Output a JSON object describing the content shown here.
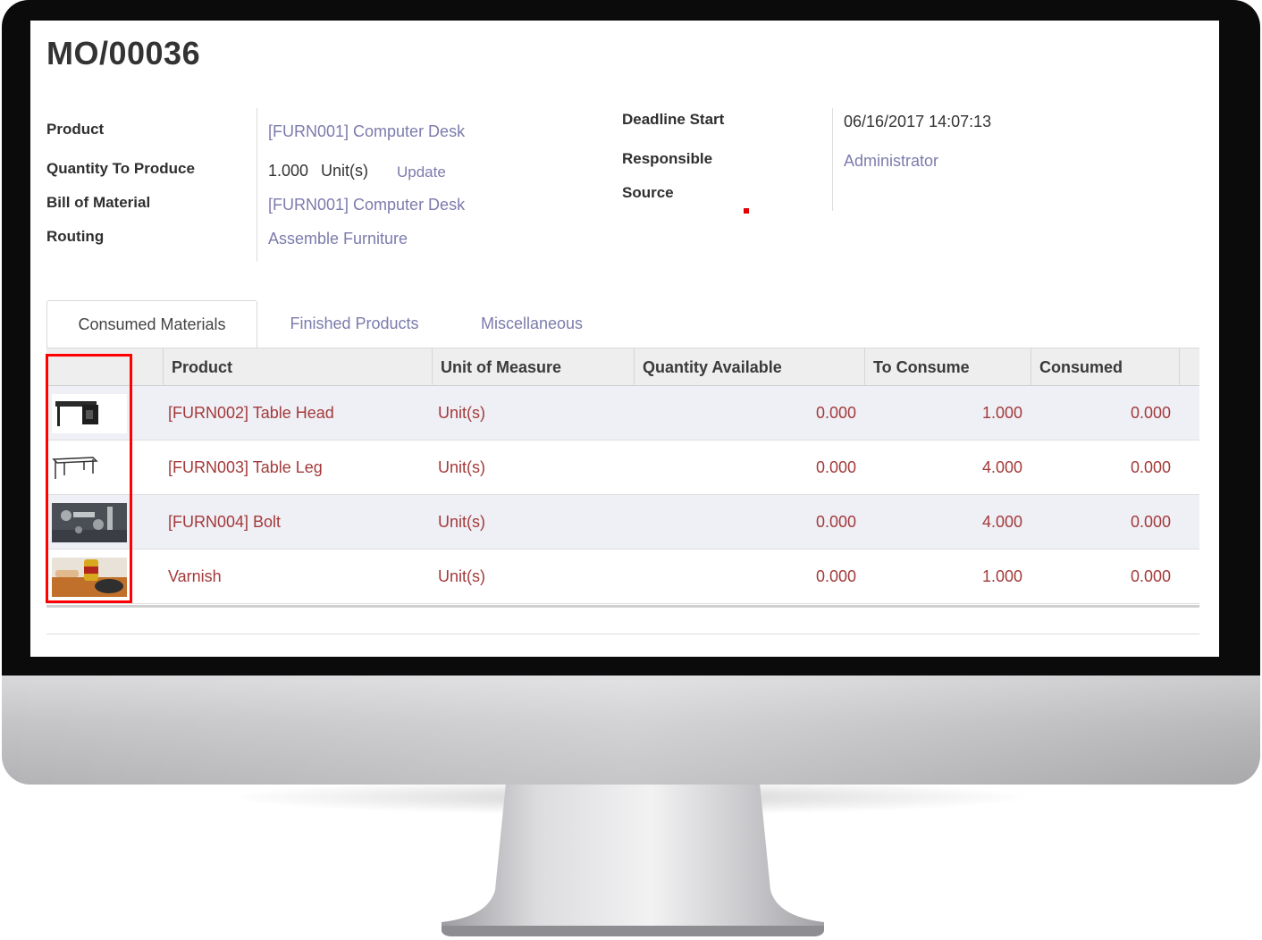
{
  "record": {
    "title": "MO/00036"
  },
  "fields_left": {
    "product_label": "Product",
    "product_value": "[FURN001] Computer Desk",
    "quantity_label": "Quantity To Produce",
    "quantity_value": "1.000",
    "quantity_uom": "Unit(s)",
    "update_link": "Update",
    "bom_label": "Bill of Material",
    "bom_value": "[FURN001] Computer Desk",
    "routing_label": "Routing",
    "routing_value": "Assemble Furniture"
  },
  "fields_right": {
    "deadline_label": "Deadline Start",
    "deadline_value": "06/16/2017 14:07:13",
    "responsible_label": "Responsible",
    "responsible_value": "Administrator",
    "source_label": "Source"
  },
  "tabs": [
    {
      "label": "Consumed Materials",
      "active": true
    },
    {
      "label": "Finished Products",
      "active": false
    },
    {
      "label": "Miscellaneous",
      "active": false
    }
  ],
  "table": {
    "headers": [
      "",
      "Product",
      "Unit of Measure",
      "Quantity Available",
      "To Consume",
      "Consumed"
    ],
    "rows": [
      {
        "image": "table-head-image",
        "product": "[FURN002] Table Head",
        "uom": "Unit(s)",
        "qty_available": "0.000",
        "to_consume": "1.000",
        "consumed": "0.000"
      },
      {
        "image": "table-leg-image",
        "product": "[FURN003] Table Leg",
        "uom": "Unit(s)",
        "qty_available": "0.000",
        "to_consume": "4.000",
        "consumed": "0.000"
      },
      {
        "image": "bolt-image",
        "product": "[FURN004] Bolt",
        "uom": "Unit(s)",
        "qty_available": "0.000",
        "to_consume": "4.000",
        "consumed": "0.000"
      },
      {
        "image": "varnish-image",
        "product": "Varnish",
        "uom": "Unit(s)",
        "qty_available": "0.000",
        "to_consume": "1.000",
        "consumed": "0.000"
      }
    ]
  },
  "colors": {
    "link": "#7c7bad",
    "row_text": "#a33a3a",
    "highlight": "#ff0000",
    "bezel": "#0b0b0b"
  }
}
